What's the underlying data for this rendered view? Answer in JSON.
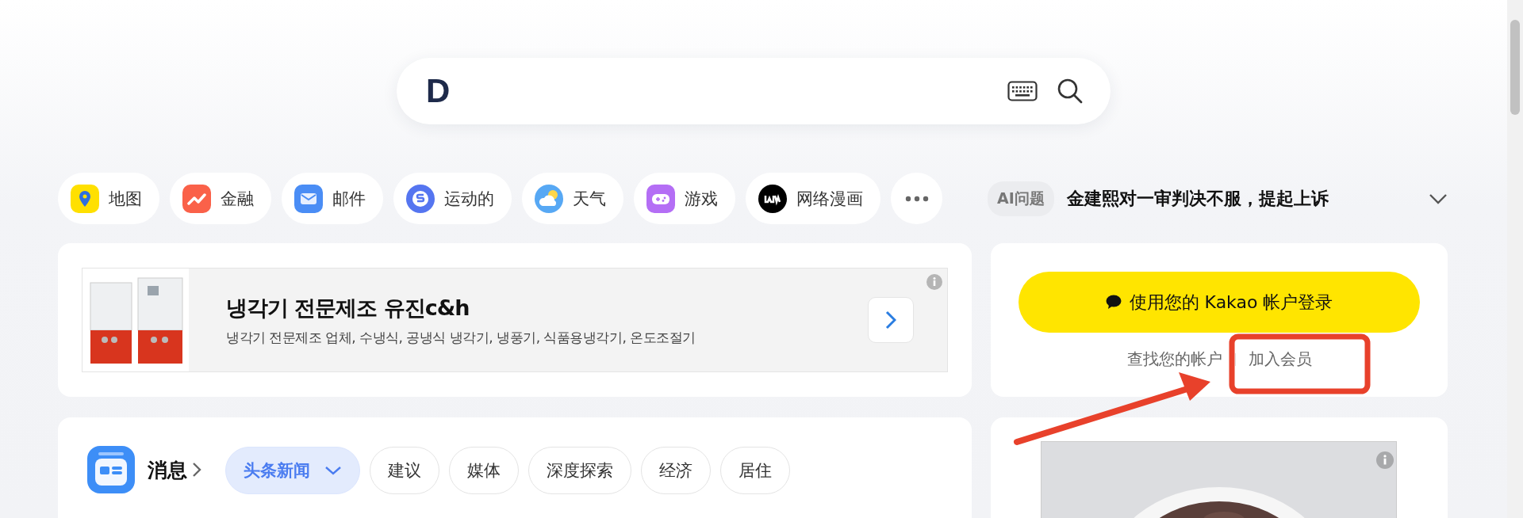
{
  "search": {
    "logo": "D"
  },
  "shortcuts": [
    {
      "label": "地图",
      "kind": "map"
    },
    {
      "label": "金融",
      "kind": "finance"
    },
    {
      "label": "邮件",
      "kind": "mail"
    },
    {
      "label": "运动的",
      "kind": "sports"
    },
    {
      "label": "天气",
      "kind": "weather"
    },
    {
      "label": "游戏",
      "kind": "game"
    },
    {
      "label": "网络漫画",
      "kind": "webtoon"
    }
  ],
  "ai_issue": {
    "badge": "AI问题",
    "headline": "金建熙对一审判决不服，提起上诉"
  },
  "ad": {
    "kind": "picture",
    "title": "냉각기 전문제조 유진c&h",
    "subtitle": "냉각기 전문제조 업체, 수냉식, 공냉식 냉각기, 냉풍기, 식품용냉각기, 온도조절기"
  },
  "login": {
    "button": "使用您的 Kakao 帐户登录",
    "find_account": "查找您的帐户",
    "join": "加入会员"
  },
  "news": {
    "title": "消息",
    "tabs": [
      {
        "label": "头条新闻",
        "selected": true
      },
      {
        "label": "建议",
        "selected": false
      },
      {
        "label": "媒体",
        "selected": false
      },
      {
        "label": "深度探索",
        "selected": false
      },
      {
        "label": "经济",
        "selected": false
      },
      {
        "label": "居住",
        "selected": false
      }
    ]
  }
}
